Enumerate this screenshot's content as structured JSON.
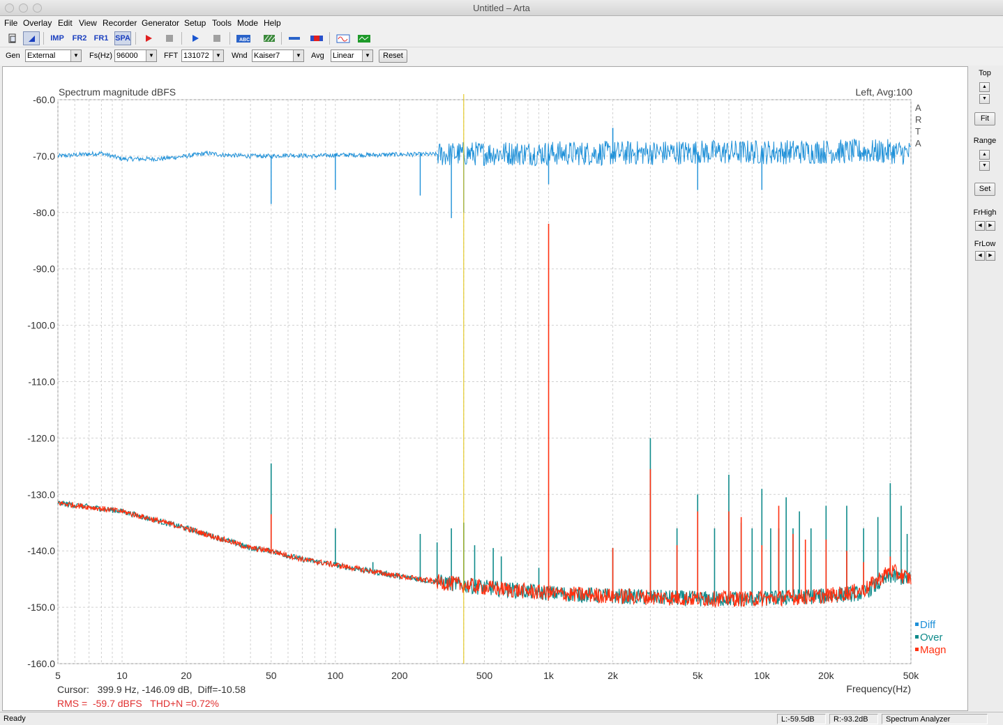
{
  "window": {
    "title": "Untitled – Arta"
  },
  "menu": [
    "File",
    "Overlay",
    "Edit",
    "View",
    "Recorder",
    "Generator",
    "Setup",
    "Tools",
    "Mode",
    "Help"
  ],
  "toolbar": {
    "imp": "IMP",
    "fr2": "FR2",
    "fr1": "FR1",
    "spa": "SPA"
  },
  "controls": {
    "gen_label": "Gen",
    "gen_value": "External",
    "fs_label": "Fs(Hz)",
    "fs_value": "96000",
    "fft_label": "FFT",
    "fft_value": "131072",
    "wnd_label": "Wnd",
    "wnd_value": "Kaiser7",
    "avg_label": "Avg",
    "avg_value": "Linear",
    "reset": "Reset"
  },
  "right_panel": {
    "top": "Top",
    "fit": "Fit",
    "range": "Range",
    "set": "Set",
    "frhigh": "FrHigh",
    "frlow": "FrLow"
  },
  "plot": {
    "title": "Spectrum magnitude dBFS",
    "channel_info": "Left, Avg:100",
    "vertical_mark": "ARTA",
    "cursor_text": "Cursor:   399.9 Hz, -146.09 dB,  Diff=-10.58",
    "rms_text": "RMS =  -59.7 dBFS   THD+N =0.72%",
    "xlabel": "Frequency(Hz)",
    "legend": [
      {
        "name": "Diff",
        "color": "#1e90d8"
      },
      {
        "name": "Over",
        "color": "#0e8a8a"
      },
      {
        "name": "Magn",
        "color": "#ff3010"
      }
    ],
    "cursor_freq": 399.9
  },
  "chart_data": {
    "type": "line",
    "title": "Spectrum magnitude dBFS",
    "xlabel": "Frequency(Hz)",
    "ylabel": "",
    "x_scale": "log",
    "xlim": [
      5,
      50000
    ],
    "ylim": [
      -160,
      -60
    ],
    "x_ticks": [
      "5",
      "10",
      "20",
      "50",
      "100",
      "200",
      "500",
      "1k",
      "2k",
      "5k",
      "10k",
      "20k",
      "50k"
    ],
    "x_tick_values": [
      5,
      10,
      20,
      50,
      100,
      200,
      500,
      1000,
      2000,
      5000,
      10000,
      20000,
      50000
    ],
    "y_ticks": [
      "-60.0",
      "-70.0",
      "-80.0",
      "-90.0",
      "-100.0",
      "-110.0",
      "-120.0",
      "-130.0",
      "-140.0",
      "-150.0",
      "-160.0"
    ],
    "y_tick_values": [
      -60,
      -70,
      -80,
      -90,
      -100,
      -110,
      -120,
      -130,
      -140,
      -150,
      -160
    ],
    "grid": true,
    "legend_position": "bottom-right",
    "series": [
      {
        "name": "Diff",
        "color": "#1e90d8",
        "x": [
          5,
          8,
          10,
          15,
          20,
          25,
          30,
          40,
          50,
          60,
          80,
          100,
          150,
          200,
          300,
          400,
          500,
          700,
          1000,
          2000,
          5000,
          10000,
          20000,
          40000,
          50000
        ],
        "y": [
          -70,
          -69.5,
          -70.5,
          -70.5,
          -70,
          -69.5,
          -69.8,
          -70,
          -70,
          -69.8,
          -70,
          -69.8,
          -69.8,
          -69.7,
          -69.7,
          -69.6,
          -69.5,
          -69.5,
          -69.5,
          -69.5,
          -69.3,
          -69.3,
          -69.2,
          -69.2,
          -69.5
        ],
        "dips": [
          [
            50,
            -78.5
          ],
          [
            100,
            -76
          ],
          [
            250,
            -77
          ],
          [
            350,
            -81
          ],
          [
            400,
            -80
          ],
          [
            1000,
            -75
          ],
          [
            5000,
            -76
          ],
          [
            10000,
            -76
          ]
        ],
        "peaks": [
          [
            2000,
            -65
          ]
        ]
      },
      {
        "name": "Over",
        "color": "#0e8a8a",
        "x": [
          5,
          10,
          20,
          30,
          40,
          50,
          70,
          100,
          200,
          300,
          500,
          1000,
          2000,
          5000,
          10000,
          20000,
          30000,
          40000,
          50000
        ],
        "y": [
          -131.5,
          -133,
          -136,
          -138,
          -139.5,
          -140,
          -141.5,
          -142.5,
          -144.5,
          -145.5,
          -146.5,
          -147.5,
          -148,
          -148.5,
          -148.5,
          -148,
          -147.5,
          -144.5,
          -145
        ],
        "peaks": [
          [
            50,
            -124.5
          ],
          [
            100,
            -136
          ],
          [
            150,
            -142
          ],
          [
            250,
            -137
          ],
          [
            300,
            -138.5
          ],
          [
            350,
            -136
          ],
          [
            400,
            -135
          ],
          [
            450,
            -139
          ],
          [
            550,
            -139.5
          ],
          [
            600,
            -141
          ],
          [
            900,
            -143
          ],
          [
            2000,
            -139.5
          ],
          [
            3000,
            -120
          ],
          [
            4000,
            -136
          ],
          [
            5000,
            -130
          ],
          [
            6000,
            -136
          ],
          [
            7000,
            -126.5
          ],
          [
            8000,
            -135
          ],
          [
            9000,
            -136
          ],
          [
            10000,
            -129
          ],
          [
            11000,
            -136
          ],
          [
            12000,
            -136
          ],
          [
            13000,
            -130.5
          ],
          [
            14000,
            -136
          ],
          [
            15000,
            -133
          ],
          [
            17000,
            -136
          ],
          [
            20000,
            -132
          ],
          [
            25000,
            -132
          ],
          [
            30000,
            -136
          ],
          [
            35000,
            -134
          ],
          [
            40000,
            -128
          ],
          [
            45000,
            -132
          ],
          [
            48000,
            -137
          ]
        ]
      },
      {
        "name": "Magn",
        "color": "#ff3010",
        "x": [
          5,
          10,
          20,
          30,
          40,
          50,
          70,
          100,
          200,
          300,
          500,
          1000,
          2000,
          5000,
          10000,
          20000,
          30000,
          40000,
          50000
        ],
        "y": [
          -131.5,
          -133,
          -136,
          -138,
          -139.5,
          -140,
          -141.5,
          -142.5,
          -144.5,
          -145.5,
          -146.5,
          -147.5,
          -148,
          -148.5,
          -148.5,
          -148,
          -147,
          -143.5,
          -145
        ],
        "peaks": [
          [
            50,
            -133.5
          ],
          [
            1000,
            -82
          ],
          [
            2000,
            -139.5
          ],
          [
            3000,
            -125.5
          ],
          [
            4000,
            -139
          ],
          [
            5000,
            -133
          ],
          [
            7000,
            -133
          ],
          [
            8000,
            -134
          ],
          [
            10000,
            -139
          ],
          [
            12000,
            -132
          ],
          [
            14000,
            -137
          ],
          [
            16000,
            -138
          ],
          [
            20000,
            -138
          ],
          [
            25000,
            -140
          ],
          [
            30000,
            -142
          ],
          [
            40000,
            -141
          ]
        ]
      }
    ]
  }
}
